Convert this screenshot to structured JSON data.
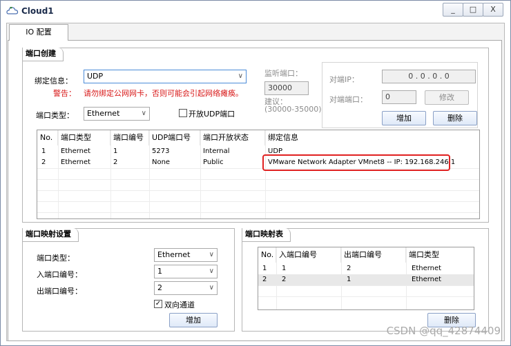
{
  "window": {
    "title": "Cloud1",
    "controls": {
      "minimize": "_",
      "maximize": "□",
      "close": "X"
    }
  },
  "tabs": [
    {
      "label": "IO 配置"
    }
  ],
  "port_creation": {
    "title": "端口创建",
    "binding_label": "绑定信息：",
    "binding_value": "UDP",
    "warning_label": "警告：",
    "warning_text": "请勿绑定公网网卡，否则可能会引起网络瘫痪。",
    "port_type_label": "端口类型：",
    "port_type_value": "Ethernet",
    "open_udp_label": "开放UDP端口",
    "listen_port_label": "监听端口：",
    "listen_port_value": "30000",
    "suggest_label": "建议：",
    "suggest_range": "(30000-35000)",
    "peer_ip_label": "对端IP：",
    "peer_ip_value": "0 . 0 . 0 . 0",
    "peer_port_label": "对端端口：",
    "peer_port_value": "0",
    "modify_button": "修改",
    "add_button": "增加",
    "delete_button": "删除"
  },
  "port_table": {
    "headers": [
      "No.",
      "端口类型",
      "端口编号",
      "UDP端口号",
      "端口开放状态",
      "绑定信息"
    ],
    "rows": [
      [
        "1",
        "Ethernet",
        "1",
        "5273",
        "Internal",
        "UDP"
      ],
      [
        "2",
        "Ethernet",
        "2",
        "None",
        "Public",
        "VMware Network Adapter VMnet8 -- IP: 192.168.246.1"
      ]
    ]
  },
  "mapping_settings": {
    "title": "端口映射设置",
    "port_type_label": "端口类型：",
    "port_type_value": "Ethernet",
    "in_port_label": "入端口编号：",
    "in_port_value": "1",
    "out_port_label": "出端口编号：",
    "out_port_value": "2",
    "bidirectional_label": "双向通道",
    "add_button": "增加"
  },
  "mapping_table": {
    "title": "端口映射表",
    "headers": [
      "No.",
      "入端口编号",
      "出端口编号",
      "端口类型"
    ],
    "rows": [
      [
        "1",
        "1",
        "2",
        "Ethernet"
      ],
      [
        "2",
        "2",
        "1",
        "Ethernet"
      ]
    ],
    "delete_button": "删除"
  },
  "watermark": "CSDN @qq_42874409",
  "colors": {
    "warning": "#d81818",
    "highlight_box": "#e02020",
    "selected_row": "#e8e8e8"
  }
}
